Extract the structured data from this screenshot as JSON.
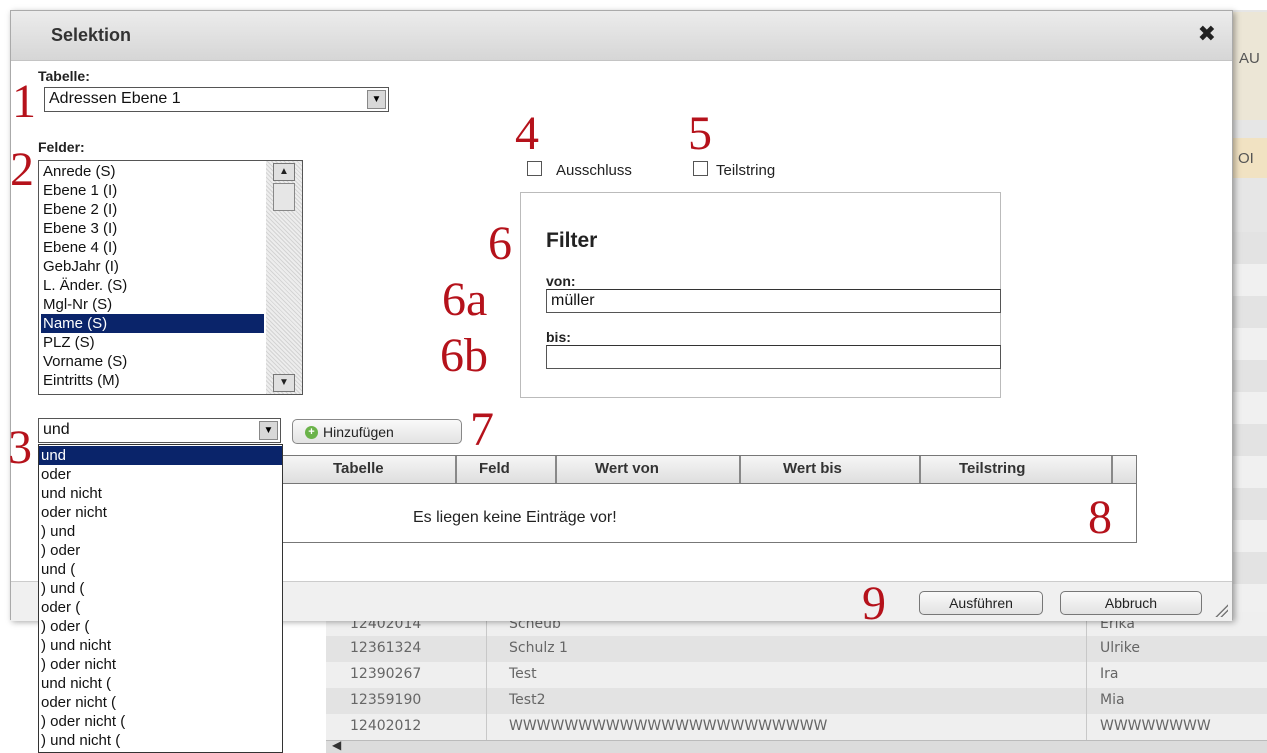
{
  "background": {
    "header_fragment_1": "AU",
    "header_fragment_2": "OI",
    "rows": [
      {
        "id": "12402014",
        "name": "Scheub",
        "first": "Erika"
      },
      {
        "id": "12361324",
        "name": "Schulz 1",
        "first": "Ulrike"
      },
      {
        "id": "12390267",
        "name": "Test",
        "first": "Ira"
      },
      {
        "id": "12359190",
        "name": "Test2",
        "first": "Mia"
      },
      {
        "id": "12402012",
        "name": "WWWWWWWWWWWWWWWWWWWWWWW",
        "first": "WWWWWWWW"
      }
    ],
    "scroll_left": "◀"
  },
  "dialog": {
    "title": "Selektion",
    "close": "✖",
    "table_label": "Tabelle:",
    "table_value": "Adressen Ebene 1",
    "fields_label": "Felder:",
    "fields": [
      "Anrede (S)",
      "Ebene 1 (I)",
      "Ebene 2 (I)",
      "Ebene 3 (I)",
      "Ebene 4 (I)",
      "GebJahr (I)",
      "L. Änder. (S)",
      "Mgl-Nr (S)",
      "Name (S)",
      "PLZ (S)",
      "Vorname (S)",
      "Eintritts (M)"
    ],
    "selected_field": "Name (S)",
    "exclusion_label": "Ausschluss",
    "substring_label": "Teilstring",
    "filter_title": "Filter",
    "from_label": "von:",
    "from_value": "müller",
    "to_label": "bis:",
    "to_value": "",
    "operator_value": "und",
    "operators": [
      "und",
      "oder",
      "und nicht",
      "oder nicht",
      ") und",
      ") oder",
      "und (",
      ") und (",
      "oder (",
      ") oder (",
      ") und nicht",
      ") oder nicht",
      "und nicht (",
      "oder nicht (",
      ") oder nicht (",
      ") und nicht ("
    ],
    "add_button": "Hinzufügen",
    "grid_headers": [
      "Tabelle",
      "Feld",
      "Wert von",
      "Wert bis",
      "Teilstring"
    ],
    "grid_empty": "Es liegen keine Einträge vor!",
    "execute_button": "Ausführen",
    "cancel_button": "Abbruch"
  },
  "annotations": [
    "1",
    "2",
    "3",
    "4",
    "5",
    "6",
    "6a",
    "6b",
    "7",
    "8",
    "9"
  ],
  "icons": {
    "close": "close-icon",
    "combo_arrow": "chevron-down-icon",
    "scroll_up": "chevron-up-icon",
    "scroll_down": "chevron-down-icon",
    "add": "plus-icon"
  },
  "colors": {
    "selection": "#0a246a",
    "annotation": "#b5121b",
    "add_icon": "#6bb34a"
  }
}
